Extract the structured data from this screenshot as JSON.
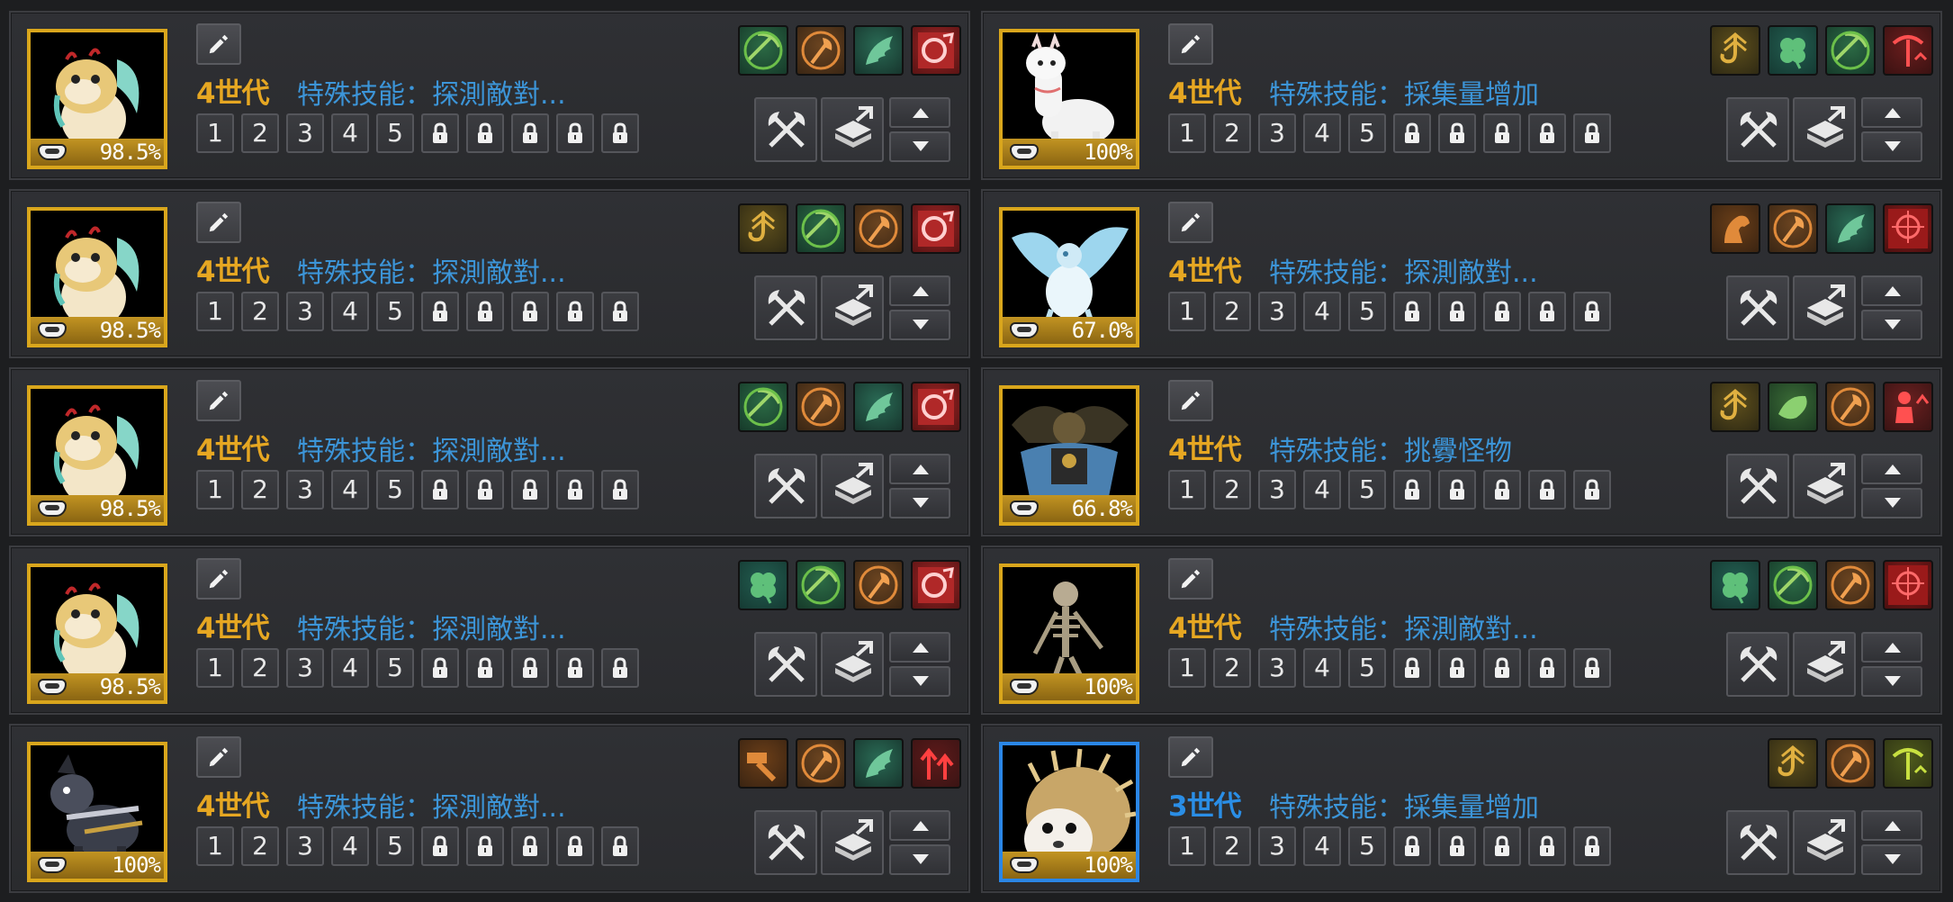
{
  "pets": [
    {
      "generation": "4世代",
      "generation_color": "gold",
      "skill": "特殊技能：探測敵對...",
      "stamina": "98.5%",
      "portrait": "cream-lion-pup",
      "frame": "gold",
      "skills": [
        "pickaxe-green",
        "axe-orange",
        "wing-green",
        "ring-red"
      ]
    },
    {
      "generation": "4世代",
      "generation_color": "gold",
      "skill": "特殊技能：採集量增加",
      "stamina": "100%",
      "portrait": "white-alpaca",
      "frame": "gold",
      "skills": [
        "hook-gold",
        "clover-green",
        "pickaxe-green",
        "pickaxe-red"
      ]
    },
    {
      "generation": "4世代",
      "generation_color": "gold",
      "skill": "特殊技能：探測敵對...",
      "stamina": "98.5%",
      "portrait": "cream-lion-pup",
      "frame": "gold",
      "skills": [
        "hook-gold",
        "pickaxe-green",
        "axe-orange",
        "ring-red"
      ]
    },
    {
      "generation": "4世代",
      "generation_color": "gold",
      "skill": "特殊技能：探測敵對...",
      "stamina": "67.0%",
      "portrait": "ice-dragon",
      "frame": "gold",
      "skills": [
        "horse-orange",
        "axe-orange",
        "wing-green",
        "target-red"
      ]
    },
    {
      "generation": "4世代",
      "generation_color": "gold",
      "skill": "特殊技能：探測敵對...",
      "stamina": "98.5%",
      "portrait": "cream-lion-pup",
      "frame": "gold",
      "skills": [
        "pickaxe-green",
        "axe-orange",
        "wing-green",
        "ring-red"
      ]
    },
    {
      "generation": "4世代",
      "generation_color": "gold",
      "skill": "特殊技能：挑釁怪物",
      "stamina": "66.8%",
      "portrait": "armored-beast",
      "frame": "gold",
      "skills": [
        "hook-gold",
        "fish-green",
        "axe-orange",
        "person-red"
      ]
    },
    {
      "generation": "4世代",
      "generation_color": "gold",
      "skill": "特殊技能：探測敵對...",
      "stamina": "98.5%",
      "portrait": "cream-lion-pup",
      "frame": "gold",
      "skills": [
        "clover-green",
        "pickaxe-green",
        "axe-orange",
        "ring-red"
      ]
    },
    {
      "generation": "4世代",
      "generation_color": "gold",
      "skill": "特殊技能：探測敵對...",
      "stamina": "100%",
      "portrait": "skeleton",
      "frame": "gold",
      "skills": [
        "clover-green",
        "pickaxe-green",
        "axe-orange",
        "target-red"
      ]
    },
    {
      "generation": "4世代",
      "generation_color": "gold",
      "skill": "特殊技能：探測敵對...",
      "stamina": "100%",
      "portrait": "armored-dog",
      "frame": "gold",
      "skills": [
        "hammer-orange",
        "axe-orange",
        "wing-green",
        "arrows-red"
      ]
    },
    {
      "generation": "3世代",
      "generation_color": "blue",
      "skill": "特殊技能：採集量增加",
      "stamina": "100%",
      "portrait": "hedgehog",
      "frame": "blue",
      "skills": [
        "hook-gold",
        "axe-orange",
        "pickaxe-yellow"
      ]
    }
  ],
  "slot_labels": [
    "1",
    "2",
    "3",
    "4",
    "5"
  ],
  "locked_slots": 5,
  "colors": {
    "gold": "#e6a722",
    "blue_text": "#3c95d8",
    "blue_gen": "#2a8ee6",
    "frame_gold": "#d9a61c",
    "frame_blue": "#2a86e6"
  },
  "icons": {
    "edit": "pencil-icon",
    "lock": "padlock-icon",
    "bowl": "feed-bowl-icon",
    "action_1": "crossed-axes-icon",
    "action_2": "box-exchange-icon",
    "up": "arrow-up-icon",
    "down": "arrow-down-icon"
  }
}
